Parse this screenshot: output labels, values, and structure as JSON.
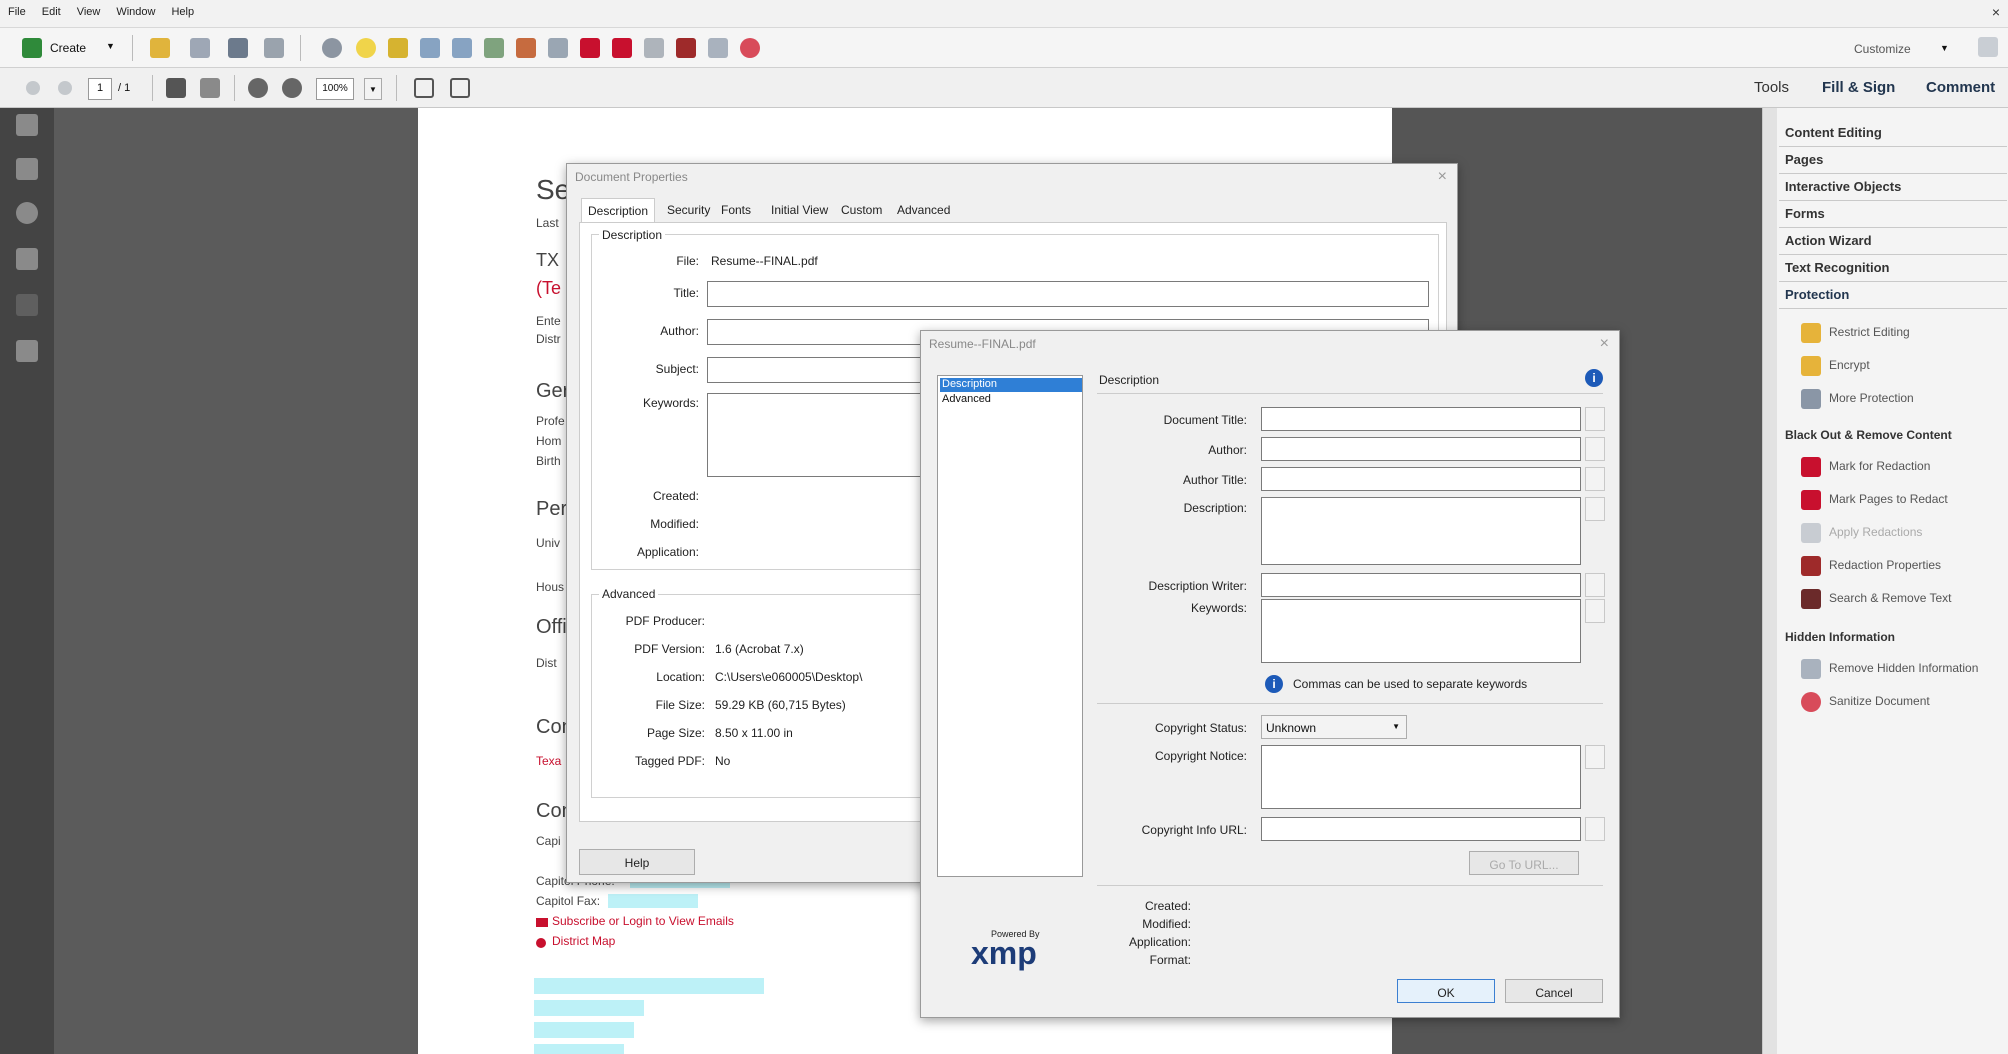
{
  "menu": [
    "File",
    "Edit",
    "View",
    "Window",
    "Help"
  ],
  "toolbar": {
    "create_label": "Create",
    "customize_label": "Customize",
    "page_current": "1",
    "page_total": "/ 1",
    "zoom": "100%"
  },
  "panel_tabs": {
    "tools": "Tools",
    "fill_sign": "Fill & Sign",
    "comment": "Comment"
  },
  "right_panel": {
    "headers": [
      "Content Editing",
      "Pages",
      "Interactive Objects",
      "Forms",
      "Action Wizard",
      "Text Recognition",
      "Protection"
    ],
    "protection_items": [
      "Restrict Editing",
      "Encrypt",
      "More Protection"
    ],
    "blackout_title": "Black Out & Remove Content",
    "blackout_items": [
      "Mark for Redaction",
      "Mark Pages to Redact",
      "Apply Redactions",
      "Redaction Properties",
      "Search & Remove Text"
    ],
    "hidden_title": "Hidden Information",
    "hidden_items": [
      "Remove Hidden Information",
      "Sanitize Document"
    ]
  },
  "document": {
    "lines": [
      "Se",
      "Last",
      "TX",
      "(Te",
      "Ente",
      "Distr",
      "Ger",
      "Profe",
      "Hom",
      "Birth",
      "Per",
      "Univ",
      "Hous",
      "Offi",
      "Dist",
      "Con",
      "Texa",
      "Con",
      "Capi"
    ],
    "capitol_phone": "Capitol Phone:",
    "capitol_fax": "Capitol Fax:",
    "subscribe": "Subscribe or Login to View Emails",
    "district_map": "District Map"
  },
  "doc_props": {
    "title": "Document Properties",
    "tabs": [
      "Description",
      "Security",
      "Fonts",
      "Initial View",
      "Custom",
      "Advanced"
    ],
    "description_group": "Description",
    "file_label": "File:",
    "file_value": "Resume--FINAL.pdf",
    "title_label": "Title:",
    "author_label": "Author:",
    "subject_label": "Subject:",
    "keywords_label": "Keywords:",
    "created_label": "Created:",
    "modified_label": "Modified:",
    "application_label": "Application:",
    "advanced_group": "Advanced",
    "producer_label": "PDF Producer:",
    "version_label": "PDF Version:",
    "version_value": "1.6 (Acrobat 7.x)",
    "location_label": "Location:",
    "location_value": "C:\\Users\\e060005\\Desktop\\",
    "filesize_label": "File Size:",
    "filesize_value": "59.29 KB (60,715 Bytes)",
    "pagesize_label": "Page Size:",
    "pagesize_value": "8.50 x 11.00 in",
    "tagged_label": "Tagged PDF:",
    "tagged_value": "No",
    "help_button": "Help"
  },
  "xmp": {
    "title": "Resume--FINAL.pdf",
    "nav": [
      "Description",
      "Advanced"
    ],
    "section": "Description",
    "doc_title_label": "Document Title:",
    "author_label": "Author:",
    "author_title_label": "Author Title:",
    "description_label": "Description:",
    "desc_writer_label": "Description Writer:",
    "keywords_label": "Keywords:",
    "keywords_hint": "Commas can be used to separate keywords",
    "copyright_status_label": "Copyright Status:",
    "copyright_status_value": "Unknown",
    "copyright_notice_label": "Copyright Notice:",
    "copyright_url_label": "Copyright Info URL:",
    "goto_url": "Go To URL...",
    "created_label": "Created:",
    "modified_label": "Modified:",
    "application_label": "Application:",
    "format_label": "Format:",
    "powered_by": "Powered By",
    "xmp_logo": "xmp",
    "ok_button": "OK",
    "cancel_button": "Cancel"
  },
  "colors": {
    "accent_blue": "#1d5ab8",
    "redact_red": "#c8102e",
    "highlight_cyan": "#bdf1f7"
  }
}
